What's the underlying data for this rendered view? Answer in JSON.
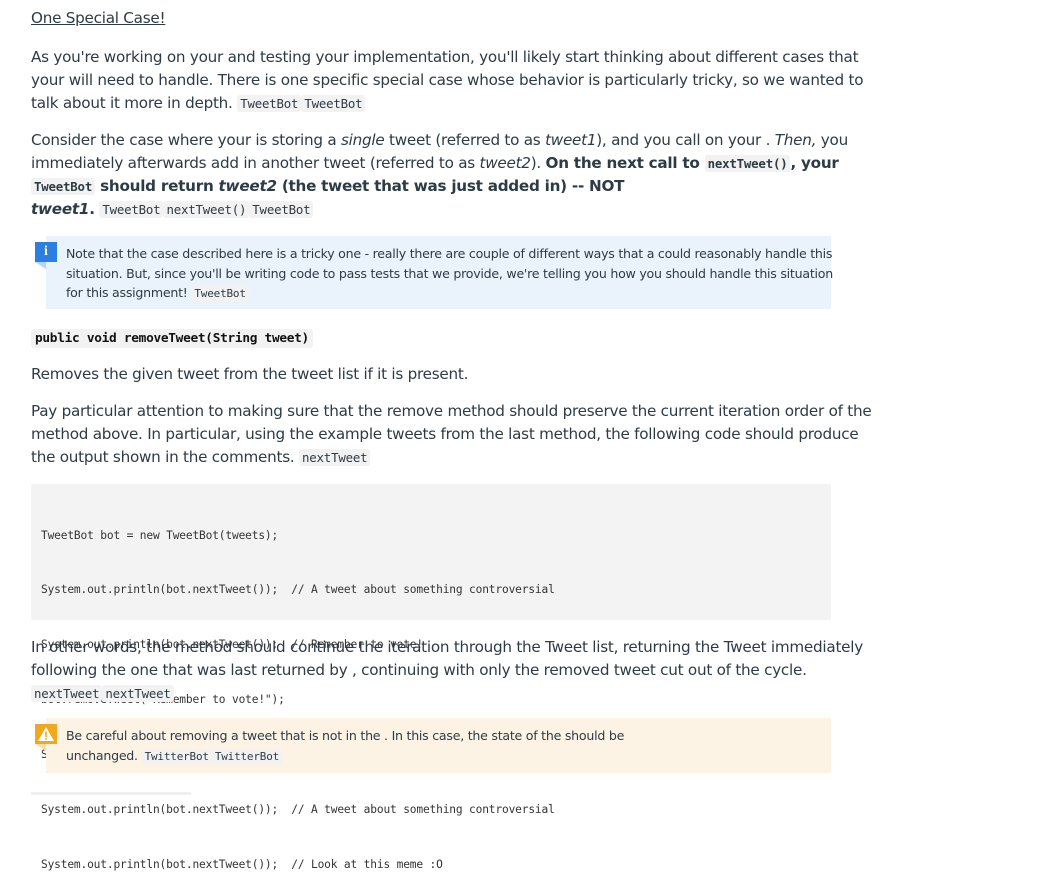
{
  "heading": "One Special Case!",
  "intro": {
    "line1": "As you're working on your  and testing your implementation, you'll likely start thinking about different cases that",
    "line2": "your  will need to handle. There is one specific special case whose behavior is particularly tricky, so we wanted to",
    "line3": "talk about it more in depth.",
    "codes": [
      "TweetBot",
      "TweetBot"
    ]
  },
  "consider": {
    "l1_a": "Consider the case where your  is storing a ",
    "l1_b": "single",
    "l1_c": " tweet (referred to as ",
    "l1_d": "tweet1",
    "l1_e": "), and you call  on your . ",
    "l1_f": "Then,",
    "l1_g": " you",
    "l2_a": "immediately afterwards add in another tweet (referred to as ",
    "l2_b": "tweet2",
    "l2_c": "). ",
    "l2_d": "On the next call to ",
    "l2_code": "nextTweet()",
    "l2_e": ", your",
    "l3_code": "TweetBot",
    "l3_a": " should return ",
    "l3_b": "tweet2",
    "l3_c": " (the tweet that was just added in) -- NOT",
    "l4_a": "tweet1",
    "l4_b": ".",
    "l4_codes": [
      "TweetBot",
      "nextTweet()",
      "TweetBot"
    ]
  },
  "info_callout": {
    "icon": "info-icon",
    "icon_glyph": "i",
    "line1": "Note that the case described here is a tricky one - really there are couple of different ways that a  could reasonably handle this",
    "line2": "situation. But, since you'll be writing code to pass tests that we provide, we're telling you how you should handle this situation",
    "line3": "for this assignment!",
    "code": "TweetBot"
  },
  "method_signature": "public void removeTweet(String tweet)",
  "removes_text": "Removes the given tweet from the tweet list if it is present.",
  "pay_attention": {
    "line1": "Pay particular attention to making sure that the remove method should preserve the current iteration order of the",
    "line2": "method above. In particular, using the example tweets from the last method, the following code should produce",
    "line3": "the output shown in the comments.",
    "code": "nextTweet"
  },
  "code_block": {
    "lines": [
      "TweetBot bot = new TweetBot(tweets);",
      "System.out.println(bot.nextTweet());  // A tweet about something controversial",
      "System.out.println(bot.nextTweet());  // Remember to vote!",
      "bot.removeTweet(\"Remember to vote!\");",
      "System.out.println(bot.nextTweet());  // Look at this meme :O",
      "System.out.println(bot.nextTweet());  // A tweet about something controversial",
      "System.out.println(bot.nextTweet());  // Look at this meme :O"
    ]
  },
  "other_words": {
    "line1": "In other words, the  method should continue the iteration through the Tweet list, returning the Tweet immediately",
    "line2": "following the one that was last returned by , continuing with only the removed tweet cut out of the cycle.",
    "codes": [
      "nextTweet",
      "nextTweet"
    ]
  },
  "warn_callout": {
    "icon": "warning-icon",
    "icon_glyph": "!",
    "line1": "Be careful about removing a tweet that is not in the . In this case, the state of the  should be",
    "line2": "unchanged.",
    "codes": [
      "TwitterBot",
      "TwitterBot"
    ]
  },
  "colors": {
    "info_bg": "#eaf2fc",
    "info_icon": "#2b7fe1",
    "warn_bg": "#fdf3e5",
    "warn_icon": "#f0a81c",
    "code_bg": "#f2f2f2",
    "text": "#2d3b45"
  }
}
